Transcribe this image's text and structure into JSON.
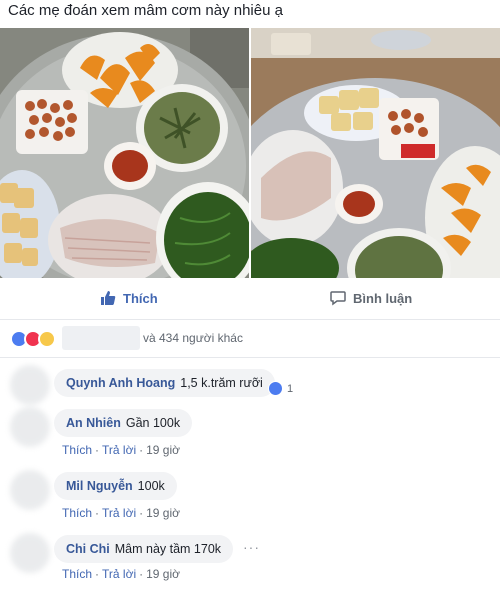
{
  "post": {
    "caption": "Các mẹ đoán xem mâm cơm này nhiêu ạ"
  },
  "actions": {
    "like_label": "Thích",
    "comment_label": "Bình luận"
  },
  "reactions": {
    "others_text": "và 434 người khác",
    "icons": [
      "like-icon",
      "love-icon",
      "wow-icon"
    ]
  },
  "comments": [
    {
      "author": "Quynh Anh Hoang",
      "text": "1,5 k.trăm rưỡi",
      "reaction_count": "1"
    },
    {
      "author": "An Nhiên",
      "text": "Gần 100k",
      "like_label": "Thích",
      "reply_label": "Trả lời",
      "time": "19 giờ"
    },
    {
      "author": "Mil Nguyễn",
      "text": "100k",
      "like_label": "Thích",
      "reply_label": "Trả lời",
      "time": "19 giờ"
    },
    {
      "author": "Chi Chi",
      "text": "Mâm này tầm 170k",
      "like_label": "Thích",
      "reply_label": "Trả lời",
      "time": "19 giờ",
      "more_label": "···"
    }
  ],
  "colors": {
    "accent": "#4267b2",
    "author": "#385898",
    "bubble": "#f2f3f5"
  }
}
